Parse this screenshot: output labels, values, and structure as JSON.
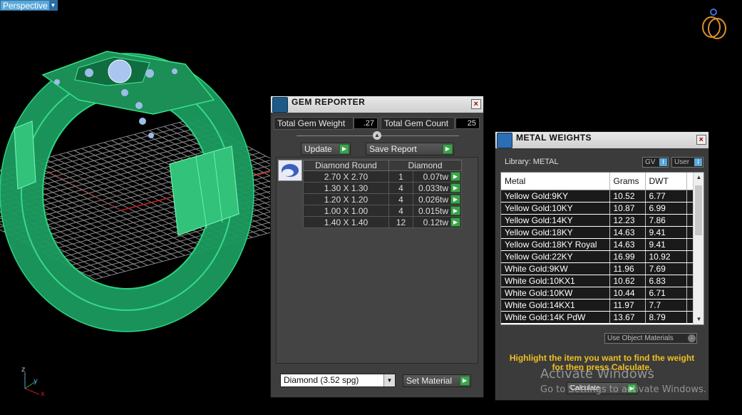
{
  "viewport": {
    "label": "Perspective",
    "axes": {
      "x": "x",
      "y": "y",
      "z": "z"
    }
  },
  "gem_reporter": {
    "title": "GEM REPORTER",
    "close": "×",
    "total_weight_label": "Total Gem Weight",
    "total_weight_value": ".27",
    "total_count_label": "Total Gem Count",
    "total_count_value": "25",
    "update_label": "Update",
    "save_report_label": "Save Report",
    "table": {
      "headers": [
        "Diamond Round",
        "Diamond"
      ],
      "rows": [
        {
          "size": "2.70 X 2.70",
          "count": "1",
          "weight": "0.07tw"
        },
        {
          "size": "1.30 X 1.30",
          "count": "4",
          "weight": "0.033tw"
        },
        {
          "size": "1.20 X 1.20",
          "count": "4",
          "weight": "0.026tw"
        },
        {
          "size": "1.00 X 1.00",
          "count": "4",
          "weight": "0.015tw"
        },
        {
          "size": "1.40 X 1.40",
          "count": "12",
          "weight": "0.12tw"
        }
      ]
    },
    "material_select": "Diamond     (3.52 spg)",
    "set_material_label": "Set Material"
  },
  "metal_weights": {
    "title": "METAL WEIGHTS",
    "close": "×",
    "library_label": "Library:  METAL",
    "gv_label": "GV",
    "user_label": "User",
    "columns": [
      "Metal",
      "Grams",
      "DWT"
    ],
    "rows": [
      {
        "metal": "Yellow Gold:9KY",
        "grams": "10.52",
        "dwt": "6.77"
      },
      {
        "metal": "Yellow Gold:10KY",
        "grams": "10.87",
        "dwt": "6.99"
      },
      {
        "metal": "Yellow Gold:14KY",
        "grams": "12.23",
        "dwt": "7.86"
      },
      {
        "metal": "Yellow Gold:18KY",
        "grams": "14.63",
        "dwt": "9.41"
      },
      {
        "metal": "Yellow Gold:18KY Royal",
        "grams": "14.63",
        "dwt": "9.41"
      },
      {
        "metal": "Yellow Gold:22KY",
        "grams": "16.99",
        "dwt": "10.92"
      },
      {
        "metal": "White Gold:9KW",
        "grams": "11.96",
        "dwt": "7.69"
      },
      {
        "metal": "White Gold:10KX1",
        "grams": "10.62",
        "dwt": "6.83"
      },
      {
        "metal": "White Gold:10KW",
        "grams": "10.44",
        "dwt": "6.71"
      },
      {
        "metal": "White Gold:14KX1",
        "grams": "11.97",
        "dwt": "7.7"
      },
      {
        "metal": "White Gold:14K PdW",
        "grams": "13.67",
        "dwt": "8.79"
      }
    ],
    "use_object_materials_label": "Use Object Materials",
    "hint_line1": "Highlight the item you want to find the weight",
    "hint_line2": "for then press Calculate.",
    "calculate_label": "Calculate"
  },
  "watermark": {
    "line1": "Activate Windows",
    "line2": "Go to Settings to activate Windows."
  }
}
